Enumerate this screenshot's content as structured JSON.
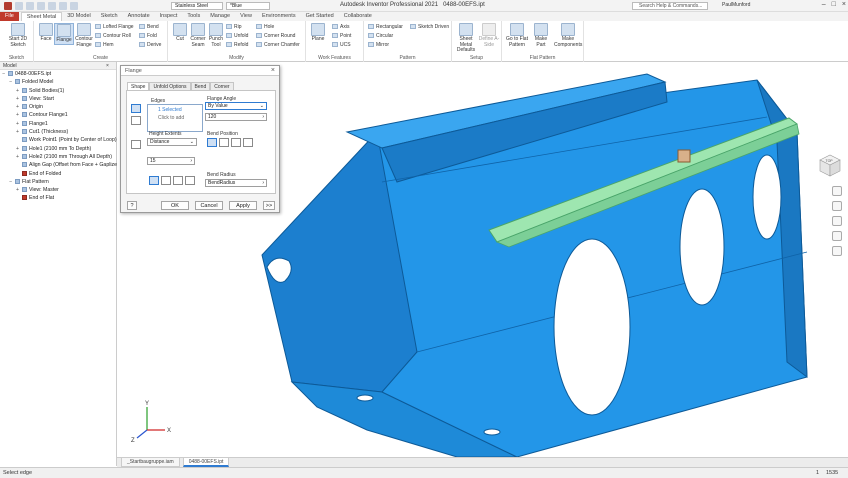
{
  "titlebar": {
    "app_title": "Autodesk Inventor Professional 2021",
    "doc_name": "0488-00EFS.ipt",
    "material": "Stainless Steel",
    "appearance": "*Blue",
    "search_placeholder": "Search Help & Commands...",
    "user": "PaulMunford"
  },
  "tabs": [
    "File",
    "Sheet Metal",
    "3D Model",
    "Sketch",
    "Annotate",
    "Inspect",
    "Tools",
    "Manage",
    "View",
    "Environments",
    "Get Started",
    "Collaborate"
  ],
  "ribbon": {
    "sketch": {
      "start": "Start 2D Sketch",
      "label": "Sketch"
    },
    "create": {
      "face": "Face",
      "flange": "Flange",
      "contour_flange": "Contour Flange",
      "lofted_flange": "Lofted Flange",
      "contour_roll": "Contour Roll",
      "hem": "Hem",
      "bend": "Bend",
      "fold": "Fold",
      "derive": "Derive",
      "label": "Create"
    },
    "modify": {
      "cut": "Cut",
      "corner_seam": "Corner Seam",
      "punch_tool": "Punch Tool",
      "rip": "Rip",
      "unfold": "Unfold",
      "refold": "Refold",
      "hole": "Hole",
      "corner_round": "Corner Round",
      "corner_chamfer": "Corner Chamfer",
      "label": "Modify"
    },
    "work_features": {
      "plane": "Plane",
      "axis": "Axis",
      "point": "Point",
      "ucs": "UCS",
      "label": "Work Features"
    },
    "pattern": {
      "rectangular": "Rectangular",
      "circular": "Circular",
      "mirror": "Mirror",
      "sketch_driven": "Sketch Driven",
      "label": "Pattern"
    },
    "setup": {
      "defaults": "Sheet Metal Defaults",
      "define_a_side": "Define A-Side",
      "label": "Setup"
    },
    "flat_pattern": {
      "goto": "Go to Flat Pattern",
      "make_part": "Make Part",
      "make_components": "Make Components",
      "label": "Flat Pattern"
    }
  },
  "browser": {
    "header": "Model",
    "rows": [
      {
        "text": "0488-00EFS.ipt",
        "indent": 0,
        "exp": "−"
      },
      {
        "text": "Folded Model",
        "indent": 1,
        "exp": "−"
      },
      {
        "text": "Solid Bodies(1)",
        "indent": 2,
        "exp": "+"
      },
      {
        "text": "View: Start",
        "indent": 2,
        "exp": "+"
      },
      {
        "text": "Origin",
        "indent": 2,
        "exp": "+"
      },
      {
        "text": "Contour Flange1",
        "indent": 2,
        "exp": "+"
      },
      {
        "text": "Flange1",
        "indent": 2,
        "exp": "+"
      },
      {
        "text": "Cut1 (Thickness)",
        "indent": 2,
        "exp": "+"
      },
      {
        "text": "Work Point1 (Point by Center of Loop)",
        "indent": 2,
        "exp": ""
      },
      {
        "text": "Hole1 (2100 mm To Depth)",
        "indent": 2,
        "exp": "+"
      },
      {
        "text": "Hole2 (2100 mm Through All Depth)",
        "indent": 2,
        "exp": "+"
      },
      {
        "text": "Align Gap (Offset from Face + Gaplize)",
        "indent": 2,
        "exp": ""
      },
      {
        "text": "End of Folded",
        "indent": 2,
        "exp": "",
        "eof": true
      },
      {
        "text": "Flat Pattern",
        "indent": 1,
        "exp": "−"
      },
      {
        "text": "View: Master",
        "indent": 2,
        "exp": "+"
      },
      {
        "text": "End of Flat",
        "indent": 2,
        "exp": "",
        "eof": true
      }
    ]
  },
  "dialog": {
    "title": "Flange",
    "tabs": [
      "Shape",
      "Unfold Options",
      "Bend",
      "Corner"
    ],
    "edges_label": "Edges",
    "edges_selected": "1 Selected",
    "edges_add": "Click to add",
    "flange_angle_label": "Flange Angle",
    "angle_mode": "By Value",
    "angle_value": "120",
    "height_extents_label": "Height Extents",
    "height_mode": "Distance",
    "height_value": "15",
    "bend_position_label": "Bend Position",
    "bend_radius_label": "Bend Radius",
    "bend_radius_value": "BendRadius",
    "ok": "OK",
    "cancel": "Cancel",
    "apply": "Apply",
    "more": ">>",
    "help": "?"
  },
  "viewcube": {
    "face": "TOP"
  },
  "doc_tabs": [
    "_Startbaugruppe.iam",
    "0488-00EFS.ipt"
  ],
  "active_doc_tab": 1,
  "status": {
    "message": "Select edge",
    "count1": "1",
    "count2": "1535"
  },
  "colors": {
    "part_blue": "#1f8fe3",
    "part_dark": "#1468ad",
    "preview_green": "#9ee6b0",
    "file_tab": "#c0392b",
    "accent": "#2f7bd1"
  }
}
